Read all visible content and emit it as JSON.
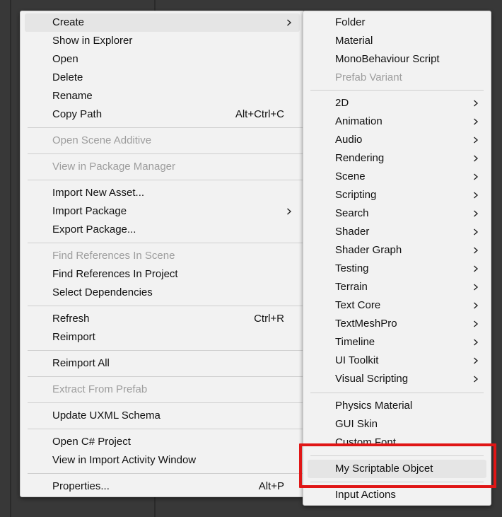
{
  "context_menu": {
    "groups": [
      [
        {
          "label": "Create",
          "shortcut": "",
          "submenu": true,
          "disabled": false,
          "highlighted": true
        },
        {
          "label": "Show in Explorer",
          "shortcut": "",
          "submenu": false,
          "disabled": false
        },
        {
          "label": "Open",
          "shortcut": "",
          "submenu": false,
          "disabled": false
        },
        {
          "label": "Delete",
          "shortcut": "",
          "submenu": false,
          "disabled": false
        },
        {
          "label": "Rename",
          "shortcut": "",
          "submenu": false,
          "disabled": false
        },
        {
          "label": "Copy Path",
          "shortcut": "Alt+Ctrl+C",
          "submenu": false,
          "disabled": false
        }
      ],
      [
        {
          "label": "Open Scene Additive",
          "shortcut": "",
          "submenu": false,
          "disabled": true
        }
      ],
      [
        {
          "label": "View in Package Manager",
          "shortcut": "",
          "submenu": false,
          "disabled": true
        }
      ],
      [
        {
          "label": "Import New Asset...",
          "shortcut": "",
          "submenu": false,
          "disabled": false
        },
        {
          "label": "Import Package",
          "shortcut": "",
          "submenu": true,
          "disabled": false
        },
        {
          "label": "Export Package...",
          "shortcut": "",
          "submenu": false,
          "disabled": false
        }
      ],
      [
        {
          "label": "Find References In Scene",
          "shortcut": "",
          "submenu": false,
          "disabled": true
        },
        {
          "label": "Find References In Project",
          "shortcut": "",
          "submenu": false,
          "disabled": false
        },
        {
          "label": "Select Dependencies",
          "shortcut": "",
          "submenu": false,
          "disabled": false
        }
      ],
      [
        {
          "label": "Refresh",
          "shortcut": "Ctrl+R",
          "submenu": false,
          "disabled": false
        },
        {
          "label": "Reimport",
          "shortcut": "",
          "submenu": false,
          "disabled": false
        }
      ],
      [
        {
          "label": "Reimport All",
          "shortcut": "",
          "submenu": false,
          "disabled": false
        }
      ],
      [
        {
          "label": "Extract From Prefab",
          "shortcut": "",
          "submenu": false,
          "disabled": true
        }
      ],
      [
        {
          "label": "Update UXML Schema",
          "shortcut": "",
          "submenu": false,
          "disabled": false
        }
      ],
      [
        {
          "label": "Open C# Project",
          "shortcut": "",
          "submenu": false,
          "disabled": false
        },
        {
          "label": "View in Import Activity Window",
          "shortcut": "",
          "submenu": false,
          "disabled": false
        }
      ],
      [
        {
          "label": "Properties...",
          "shortcut": "Alt+P",
          "submenu": false,
          "disabled": false
        }
      ]
    ]
  },
  "create_submenu": {
    "groups": [
      [
        {
          "label": "Folder",
          "submenu": false,
          "disabled": false
        },
        {
          "label": "Material",
          "submenu": false,
          "disabled": false
        },
        {
          "label": "MonoBehaviour Script",
          "submenu": false,
          "disabled": false
        },
        {
          "label": "Prefab Variant",
          "submenu": false,
          "disabled": true
        }
      ],
      [
        {
          "label": "2D",
          "submenu": true,
          "disabled": false
        },
        {
          "label": "Animation",
          "submenu": true,
          "disabled": false
        },
        {
          "label": "Audio",
          "submenu": true,
          "disabled": false
        },
        {
          "label": "Rendering",
          "submenu": true,
          "disabled": false
        },
        {
          "label": "Scene",
          "submenu": true,
          "disabled": false
        },
        {
          "label": "Scripting",
          "submenu": true,
          "disabled": false
        },
        {
          "label": "Search",
          "submenu": true,
          "disabled": false
        },
        {
          "label": "Shader",
          "submenu": true,
          "disabled": false
        },
        {
          "label": "Shader Graph",
          "submenu": true,
          "disabled": false
        },
        {
          "label": "Testing",
          "submenu": true,
          "disabled": false
        },
        {
          "label": "Terrain",
          "submenu": true,
          "disabled": false
        },
        {
          "label": "Text Core",
          "submenu": true,
          "disabled": false
        },
        {
          "label": "TextMeshPro",
          "submenu": true,
          "disabled": false
        },
        {
          "label": "Timeline",
          "submenu": true,
          "disabled": false
        },
        {
          "label": "UI Toolkit",
          "submenu": true,
          "disabled": false
        },
        {
          "label": "Visual Scripting",
          "submenu": true,
          "disabled": false
        }
      ],
      [
        {
          "label": "Physics Material",
          "submenu": false,
          "disabled": false
        },
        {
          "label": "GUI Skin",
          "submenu": false,
          "disabled": false
        },
        {
          "label": "Custom Font",
          "submenu": false,
          "disabled": false
        }
      ],
      [
        {
          "label": "My Scriptable Objcet",
          "submenu": false,
          "disabled": false,
          "highlighted": true
        }
      ],
      [
        {
          "label": "Input Actions",
          "submenu": false,
          "disabled": false
        }
      ]
    ]
  },
  "annotation": {
    "highlight_color": "#e01616"
  },
  "colors": {
    "menu_bg": "#f2f2f2",
    "hover_bg": "#e5e5e5",
    "disabled_text": "#9d9d9d",
    "background": "#383838"
  }
}
